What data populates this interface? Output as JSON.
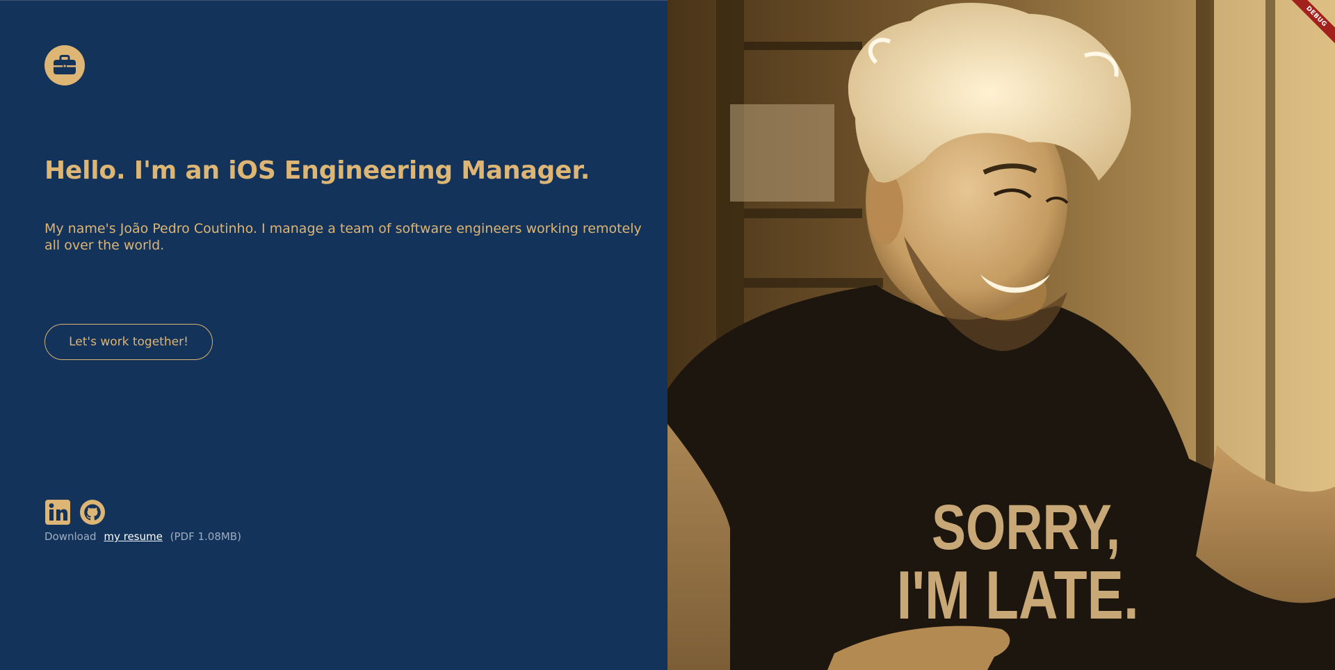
{
  "hero": {
    "headline": "Hello. I'm an iOS Engineering Manager.",
    "intro": "My name's João Pedro Coutinho. I manage a team of software engineers working remotely all over the world.",
    "cta_label": "Let's work together!"
  },
  "social": {
    "linkedin_icon": "linkedin-icon",
    "github_icon": "github-icon"
  },
  "resume": {
    "prefix": "Download",
    "link_label": "my resume",
    "suffix": "(PDF 1.08MB)"
  },
  "photo": {
    "shirt_line_1": "SORRY,",
    "shirt_line_2": "I'M LATE."
  },
  "debug_banner": {
    "label": "DEBUG"
  },
  "colors": {
    "background": "#13335a",
    "accent": "#ddb574",
    "debug": "#a3211c"
  },
  "icons": {
    "logo": "briefcase-icon"
  }
}
